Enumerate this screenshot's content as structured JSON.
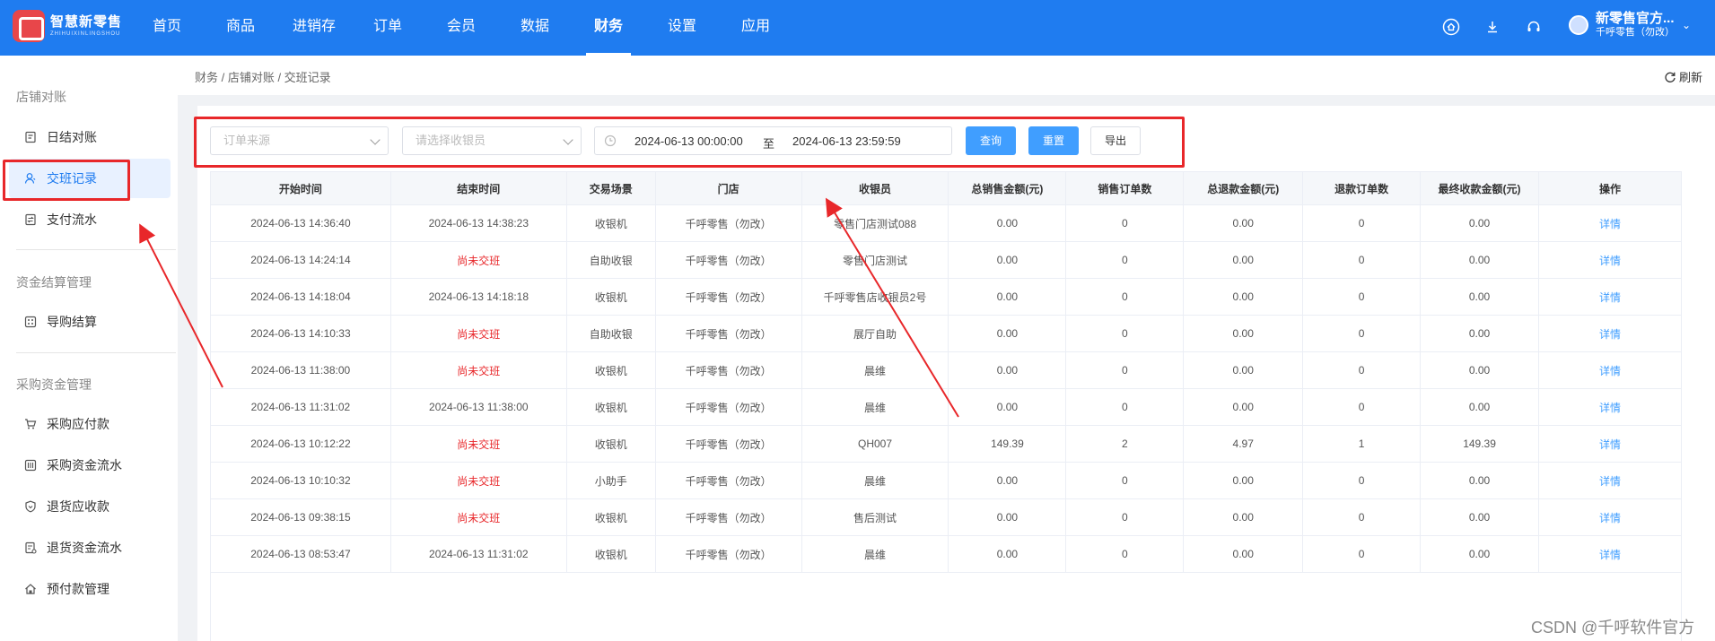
{
  "app": {
    "brand_zh": "智慧新零售",
    "brand_en": "ZHIHUIXINLINGSHOU"
  },
  "nav": [
    "首页",
    "商品",
    "进销存",
    "订单",
    "会员",
    "数据",
    "财务",
    "设置",
    "应用"
  ],
  "nav_active": "财务",
  "user": {
    "name": "新零售官方...",
    "store": "千呼零售（勿改）"
  },
  "sidebar": {
    "groups": [
      {
        "title": "店铺对账",
        "items": [
          "日结对账",
          "交班记录",
          "支付流水"
        ]
      },
      {
        "title": "资金结算管理",
        "items": [
          "导购结算"
        ]
      },
      {
        "title": "采购资金管理",
        "items": [
          "采购应付款",
          "采购资金流水",
          "退货应收款",
          "退货资金流水",
          "预付款管理"
        ]
      }
    ],
    "active": "交班记录"
  },
  "breadcrumb": "财务 / 店铺对账 / 交班记录",
  "refresh_label": "刷新",
  "filters": {
    "source_placeholder": "订单来源",
    "cashier_placeholder": "请选择收银员",
    "date_start": "2024-06-13 00:00:00",
    "date_sep": "至",
    "date_end": "2024-06-13 23:59:59",
    "query_label": "查询",
    "reset_label": "重置",
    "export_label": "导出"
  },
  "table": {
    "headers": [
      "开始时间",
      "结束时间",
      "交易场景",
      "门店",
      "收银员",
      "总销售金额(元)",
      "销售订单数",
      "总退款金额(元)",
      "退款订单数",
      "最终收款金额(元)",
      "操作"
    ],
    "rows": [
      [
        "2024-06-13 14:36:40",
        "2024-06-13 14:38:23",
        "收银机",
        "千呼零售（勿改）",
        "零售门店测试088",
        "0.00",
        "0",
        "0.00",
        "0",
        "0.00",
        "详情"
      ],
      [
        "2024-06-13 14:24:14",
        "尚未交班",
        "自助收银",
        "千呼零售（勿改）",
        "零售门店测试",
        "0.00",
        "0",
        "0.00",
        "0",
        "0.00",
        "详情"
      ],
      [
        "2024-06-13 14:18:04",
        "2024-06-13 14:18:18",
        "收银机",
        "千呼零售（勿改）",
        "千呼零售店收银员2号",
        "0.00",
        "0",
        "0.00",
        "0",
        "0.00",
        "详情"
      ],
      [
        "2024-06-13 14:10:33",
        "尚未交班",
        "自助收银",
        "千呼零售（勿改）",
        "展厅自助",
        "0.00",
        "0",
        "0.00",
        "0",
        "0.00",
        "详情"
      ],
      [
        "2024-06-13 11:38:00",
        "尚未交班",
        "收银机",
        "千呼零售（勿改）",
        "晨维",
        "0.00",
        "0",
        "0.00",
        "0",
        "0.00",
        "详情"
      ],
      [
        "2024-06-13 11:31:02",
        "2024-06-13 11:38:00",
        "收银机",
        "千呼零售（勿改）",
        "晨维",
        "0.00",
        "0",
        "0.00",
        "0",
        "0.00",
        "详情"
      ],
      [
        "2024-06-13 10:12:22",
        "尚未交班",
        "收银机",
        "千呼零售（勿改）",
        "QH007",
        "149.39",
        "2",
        "4.97",
        "1",
        "149.39",
        "详情"
      ],
      [
        "2024-06-13 10:10:32",
        "尚未交班",
        "小助手",
        "千呼零售（勿改）",
        "晨维",
        "0.00",
        "0",
        "0.00",
        "0",
        "0.00",
        "详情"
      ],
      [
        "2024-06-13 09:38:15",
        "尚未交班",
        "收银机",
        "千呼零售（勿改）",
        "售后测试",
        "0.00",
        "0",
        "0.00",
        "0",
        "0.00",
        "详情"
      ],
      [
        "2024-06-13 08:53:47",
        "2024-06-13 11:31:02",
        "收银机",
        "千呼零售（勿改）",
        "晨维",
        "0.00",
        "0",
        "0.00",
        "0",
        "0.00",
        "详情"
      ]
    ]
  },
  "status_not_handed": "尚未交班",
  "watermark": "CSDN @千呼软件官方",
  "colors": {
    "primary": "#1f7cf0",
    "accent": "#409eff",
    "highlight": "#e8272a"
  }
}
